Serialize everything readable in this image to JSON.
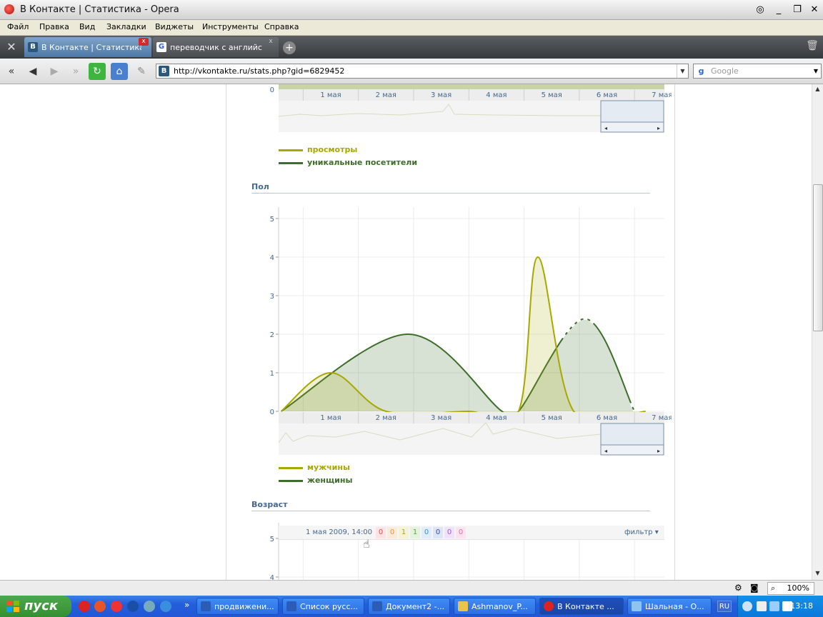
{
  "window": {
    "title": "В Контакте | Статистика - Opera"
  },
  "menu": [
    "Файл",
    "Правка",
    "Вид",
    "Закладки",
    "Виджеты",
    "Инструменты",
    "Справка"
  ],
  "tabs": [
    {
      "label": "В Контакте | Статистика",
      "favicon": "В"
    },
    {
      "label": "переводчик с английс...",
      "favicon": "G"
    }
  ],
  "address": {
    "url": "http://vkontakte.ru/stats.php?gid=6829452"
  },
  "search": {
    "placeholder": "Google"
  },
  "page": {
    "legend_views": "просмотры",
    "legend_unique": "уникальные посетители",
    "section_gender": "Пол",
    "legend_male": "мужчины",
    "legend_female": "женщины",
    "section_age": "Возраст",
    "age_tooltip_date": "1 мая 2009, 14:00",
    "age_tooltip_values": [
      "0",
      "0",
      "1",
      "1",
      "0",
      "0",
      "0",
      "0"
    ],
    "age_filter": "фильтр",
    "colors": {
      "male": "#a8a800",
      "female": "#3d6e2a",
      "link": "#45688e"
    }
  },
  "chart_data": [
    {
      "type": "area",
      "categories": [
        "1 мая",
        "2 мая",
        "3 мая",
        "4 мая",
        "5 мая",
        "6 мая",
        "7 мая"
      ],
      "yticks": [
        "0"
      ],
      "series": [
        {
          "name": "просмотры",
          "values": [
            0,
            0,
            0,
            0,
            0,
            0,
            0
          ]
        },
        {
          "name": "уникальные посетители",
          "values": [
            0,
            0,
            0,
            0,
            0,
            0,
            0
          ]
        }
      ]
    },
    {
      "type": "area",
      "categories": [
        "1 мая",
        "2 мая",
        "3 мая",
        "4 мая",
        "5 мая",
        "6 мая",
        "7 мая"
      ],
      "yticks": [
        "0",
        "1",
        "2",
        "3",
        "4",
        "5"
      ],
      "ylim": [
        0,
        5
      ],
      "series": [
        {
          "name": "мужчины",
          "x": [
            -0.9,
            0,
            1,
            2.5,
            3.4,
            3.75,
            4.4,
            5.7
          ],
          "values": [
            0,
            1,
            0,
            0,
            0,
            4,
            0,
            0
          ]
        },
        {
          "name": "женщины",
          "x": [
            -0.9,
            1.4,
            3.1,
            3.4,
            4.6,
            5.5
          ],
          "values": [
            0,
            2,
            0,
            0,
            2.4,
            0
          ]
        }
      ]
    },
    {
      "type": "area",
      "yticks": [
        "4",
        "5"
      ]
    }
  ],
  "taskbar": {
    "start": "пуск",
    "tasks": [
      "продвижени...",
      "Список русс...",
      "Документ2 -...",
      "Ashmanov_P...",
      "В Контакте ...",
      "Шальная - О..."
    ],
    "lang": "RU",
    "clock": "13:18"
  },
  "status": {
    "zoom": "100%"
  }
}
